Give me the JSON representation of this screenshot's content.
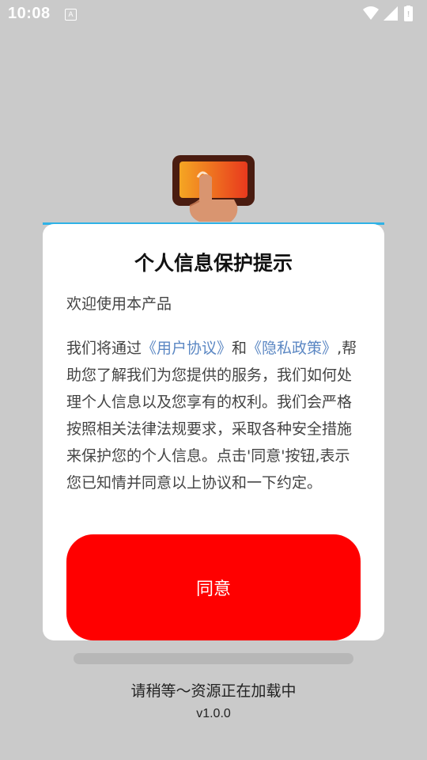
{
  "status_bar": {
    "time": "10:08",
    "notification_icon": "A"
  },
  "dialog": {
    "title": "个人信息保护提示",
    "welcome": "欢迎使用本产品",
    "body_pre": "我们将通过",
    "link_user_agreement": "《用户协议》",
    "body_and": "和",
    "link_privacy_policy": "《隐私政策》",
    "body_post": ",帮助您了解我们为您提供的服务，我们如何处理个人信息以及您享有的权利。我们会严格按照相关法律法规要求，采取各种安全措施来保护您的个人信息。点击'同意'按钮,表示您已知情并同意以上协议和一下约定。",
    "agree_label": "同意"
  },
  "loading": {
    "progress": 0,
    "text": "请稍等～资源正在加载中",
    "version": "v1.0.0"
  },
  "colors": {
    "accent_button": "#ff0000",
    "link": "#5b87c3",
    "dialog_top_line": "#2fb2e6"
  }
}
